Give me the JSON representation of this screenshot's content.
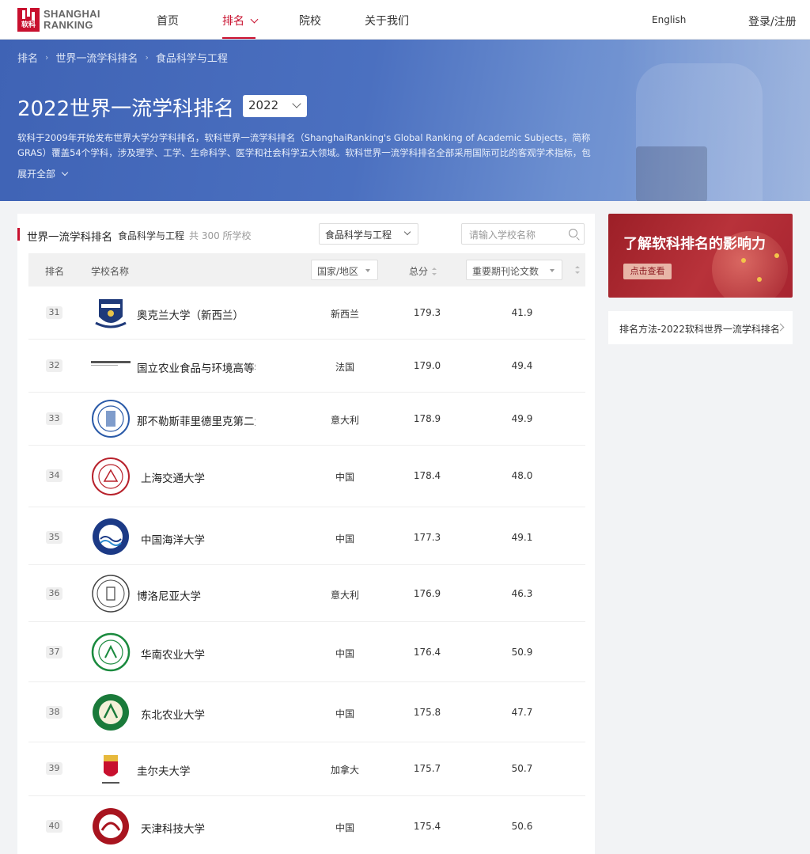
{
  "logo": {
    "line1": "SHANGHAI",
    "line2": "RANKING",
    "mark": "软科"
  },
  "nav": {
    "home": "首页",
    "rankings": "排名",
    "universities": "院校",
    "about": "关于我们",
    "lang": "English",
    "login": "登录/注册"
  },
  "breadcrumb": [
    "排名",
    "世界一流学科排名",
    "食品科学与工程"
  ],
  "banner": {
    "title": "2022世界一流学科排名",
    "year": "2022",
    "intro": "软科于2009年开始发布世界大学分学科排名，软科世界一流学科排名（ShanghaiRanking's Global Ranking of Academic Subjects，简称GRAS）覆盖54个学科，涉及理学、工学、生命科学、医学和社会科学五大领域。软科世界一流学科排名全部采用国际可比的客观学术指标，包",
    "expand": "展开全部"
  },
  "table": {
    "title": "世界一流学科排名",
    "subject": "食品科学与工程",
    "count": "共 300 所学校",
    "subject_select": "食品科学与工程",
    "search_placeholder": "请输入学校名称",
    "headers": {
      "rank": "排名",
      "name": "学校名称",
      "country": "国家/地区",
      "score": "总分",
      "papers": "重要期刊论文数"
    },
    "rows": [
      {
        "rank": "31",
        "name": "奥克兰大学（新西兰）",
        "country": "新西兰",
        "score": "179.3",
        "papers": "41.9"
      },
      {
        "rank": "32",
        "name": "国立农业食品与环境高等学院",
        "country": "法国",
        "score": "179.0",
        "papers": "49.4"
      },
      {
        "rank": "33",
        "name": "那不勒斯菲里德里克第二大学",
        "country": "意大利",
        "score": "178.9",
        "papers": "49.9"
      },
      {
        "rank": "34",
        "name": "上海交通大学",
        "country": "中国",
        "score": "178.4",
        "papers": "48.0"
      },
      {
        "rank": "35",
        "name": "中国海洋大学",
        "country": "中国",
        "score": "177.3",
        "papers": "49.1"
      },
      {
        "rank": "36",
        "name": "博洛尼亚大学",
        "country": "意大利",
        "score": "176.9",
        "papers": "46.3"
      },
      {
        "rank": "37",
        "name": "华南农业大学",
        "country": "中国",
        "score": "176.4",
        "papers": "50.9"
      },
      {
        "rank": "38",
        "name": "东北农业大学",
        "country": "中国",
        "score": "175.8",
        "papers": "47.7"
      },
      {
        "rank": "39",
        "name": "圭尔夫大学",
        "country": "加拿大",
        "score": "175.7",
        "papers": "50.7"
      },
      {
        "rank": "40",
        "name": "天津科技大学",
        "country": "中国",
        "score": "175.4",
        "papers": "50.6"
      }
    ]
  },
  "sidebar": {
    "promo_title": "了解软科排名的影响力",
    "promo_button": "点击查看",
    "method_link": "排名方法-2022软科世界一流学科排名"
  },
  "colors": {
    "brand_red": "#c8102e",
    "banner_blue": "#4b70c0"
  }
}
